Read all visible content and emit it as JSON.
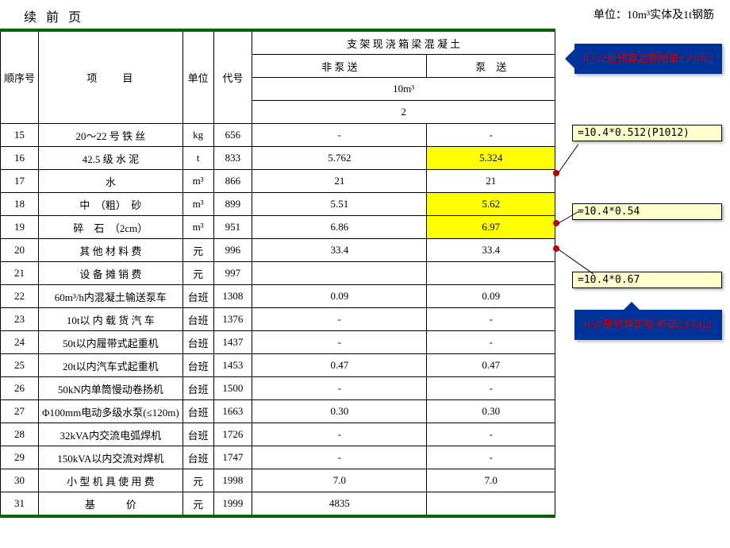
{
  "header": {
    "continued": "续 前 页",
    "unit_label": "单位：10m³实体及1t钢筋"
  },
  "columns": {
    "sn": "顺序号",
    "item": "项　　目",
    "unit": "单位",
    "code": "代号",
    "group": "支 架 现 浇 箱 梁 混 凝 土 ",
    "sub1": "非 泵 送",
    "sub2": "泵　送",
    "spec": "10m³",
    "code2": "2"
  },
  "rows": [
    {
      "sn": "15",
      "item": "20～22 号 铁 丝",
      "unit": "kg",
      "code": "656",
      "v1": "-",
      "v2": "-"
    },
    {
      "sn": "16",
      "item": "42.5 级 水 泥",
      "unit": "t",
      "code": "833",
      "v1": "5.762",
      "v2": "5.324",
      "hl2": true
    },
    {
      "sn": "17",
      "item": "水",
      "unit": "m³",
      "code": "866",
      "v1": "21",
      "v2": "21"
    },
    {
      "sn": "18",
      "item": "中　（粗）　砂",
      "unit": "m³",
      "code": "899",
      "v1": "5.51",
      "v2": "5.62",
      "hl2": true
    },
    {
      "sn": "19",
      "item": "碎　石　（2cm）",
      "unit": "m³",
      "code": "951",
      "v1": "6.86",
      "v2": "6.97",
      "hl2": true
    },
    {
      "sn": "20",
      "item": "其 他 材 料 费",
      "unit": "元",
      "code": "996",
      "v1": "33.4",
      "v2": "33.4"
    },
    {
      "sn": "21",
      "item": "设 备 摊 销 费",
      "unit": "元",
      "code": "997",
      "v1": "",
      "v2": ""
    },
    {
      "sn": "22",
      "item": "60m³/h内混凝土输送泵车",
      "unit": "台班",
      "code": "1308",
      "v1": "0.09",
      "v2": "0.09",
      "small": true
    },
    {
      "sn": "23",
      "item": "10t以 内 载 货 汽 车",
      "unit": "台班",
      "code": "1376",
      "v1": "-",
      "v2": "-",
      "small": true
    },
    {
      "sn": "24",
      "item": "50t以内履带式起重机",
      "unit": "台班",
      "code": "1437",
      "v1": "-",
      "v2": "-",
      "small": true
    },
    {
      "sn": "25",
      "item": "20t以内汽车式起重机",
      "unit": "台班",
      "code": "1453",
      "v1": "0.47",
      "v2": "0.47",
      "small": true
    },
    {
      "sn": "26",
      "item": "50kN内单筒慢动卷扬机",
      "unit": "台班",
      "code": "1500",
      "v1": "-",
      "v2": "-",
      "small": true
    },
    {
      "sn": "27",
      "item": "Φ100mm电动多级水泵(≤120m)",
      "unit": "台班",
      "code": "1663",
      "v1": "0.30",
      "v2": "0.30",
      "small": true
    },
    {
      "sn": "28",
      "item": "32kVA内交流电弧焊机",
      "unit": "台班",
      "code": "1726",
      "v1": "-",
      "v2": "-",
      "small": true
    },
    {
      "sn": "29",
      "item": "150kVA以内交流对焊机",
      "unit": "台班",
      "code": "1747",
      "v1": "-",
      "v2": "-",
      "small": true
    },
    {
      "sn": "30",
      "item": "小 型 机 具 使 用 费",
      "unit": "元",
      "code": "1998",
      "v1": "7.0",
      "v2": "7.0"
    },
    {
      "sn": "31",
      "item": "基　　　价",
      "unit": "元",
      "code": "1999",
      "v1": "4835",
      "v2": ""
    }
  ],
  "annotations": {
    "blue_top": "0.512是预算定额附录2 P1012",
    "blue_bot": "0.67是预算定额 附录2 P1012",
    "note1": "=10.4*0.512(P1012)",
    "note2": "=10.4*0.54",
    "note3": "=10.4*0.67"
  }
}
